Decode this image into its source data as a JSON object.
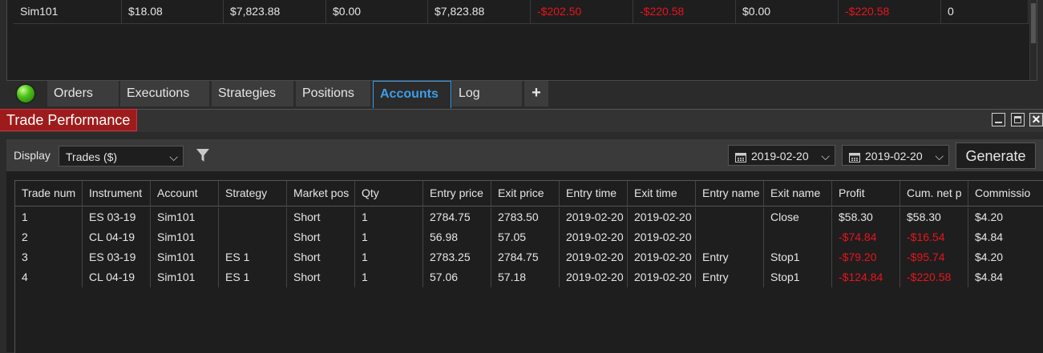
{
  "accounts_panel": {
    "row": [
      {
        "value": "Sim101",
        "negative": false
      },
      {
        "value": "$18.08",
        "negative": false
      },
      {
        "value": "$7,823.88",
        "negative": false
      },
      {
        "value": "$0.00",
        "negative": false
      },
      {
        "value": "$7,823.88",
        "negative": false
      },
      {
        "value": "-$202.50",
        "negative": true
      },
      {
        "value": "-$220.58",
        "negative": true
      },
      {
        "value": "$0.00",
        "negative": false
      },
      {
        "value": "-$220.58",
        "negative": true
      },
      {
        "value": "0",
        "negative": false
      }
    ]
  },
  "tabs": {
    "orders": "Orders",
    "executions": "Executions",
    "strategies": "Strategies",
    "positions": "Positions",
    "accounts": "Accounts",
    "log": "Log",
    "add": "+"
  },
  "window": {
    "title": "Trade Performance",
    "close_glyph": "✕"
  },
  "toolbar": {
    "display_label": "Display",
    "display_value": "Trades ($)",
    "start_date": "2019-02-20",
    "end_date": "2019-02-20",
    "generate_label": "Generate"
  },
  "grid": {
    "headers": [
      "Trade num",
      "Instrument",
      "Account",
      "Strategy",
      "Market pos",
      "Qty",
      "Entry price",
      "Exit price",
      "Entry time",
      "Exit time",
      "Entry name",
      "Exit name",
      "Profit",
      "Cum. net p",
      "Commissio"
    ],
    "rows": [
      {
        "cells": [
          "1",
          "ES 03-19",
          "Sim101",
          "",
          "Short",
          "1",
          "2784.75",
          "2783.50",
          "2019-02-20",
          "2019-02-20",
          "",
          "Close",
          "$58.30",
          "$58.30",
          "$4.20"
        ],
        "neg": [
          false,
          false,
          false,
          false,
          false,
          false,
          false,
          false,
          false,
          false,
          false,
          false,
          false,
          false,
          false
        ]
      },
      {
        "cells": [
          "2",
          "CL 04-19",
          "Sim101",
          "",
          "Short",
          "1",
          "56.98",
          "57.05",
          "2019-02-20",
          "2019-02-20",
          "",
          "",
          "-$74.84",
          "-$16.54",
          "$4.84"
        ],
        "neg": [
          false,
          false,
          false,
          false,
          false,
          false,
          false,
          false,
          false,
          false,
          false,
          false,
          true,
          true,
          false
        ]
      },
      {
        "cells": [
          "3",
          "ES 03-19",
          "Sim101",
          "ES 1",
          "Short",
          "1",
          "2783.25",
          "2784.75",
          "2019-02-20",
          "2019-02-20",
          "Entry",
          "Stop1",
          "-$79.20",
          "-$95.74",
          "$4.20"
        ],
        "neg": [
          false,
          false,
          false,
          false,
          false,
          false,
          false,
          false,
          false,
          false,
          false,
          false,
          true,
          true,
          false
        ]
      },
      {
        "cells": [
          "4",
          "CL 04-19",
          "Sim101",
          "ES 1",
          "Short",
          "1",
          "57.06",
          "57.18",
          "2019-02-20",
          "2019-02-20",
          "Entry",
          "Stop1",
          "-$124.84",
          "-$220.58",
          "$4.84"
        ],
        "neg": [
          false,
          false,
          false,
          false,
          false,
          false,
          false,
          false,
          false,
          false,
          false,
          false,
          true,
          true,
          false
        ]
      }
    ]
  },
  "colors": {
    "negative": "#e8141c",
    "active_tab": "#3d9ee8",
    "title_badge": "#9e1b1b"
  }
}
